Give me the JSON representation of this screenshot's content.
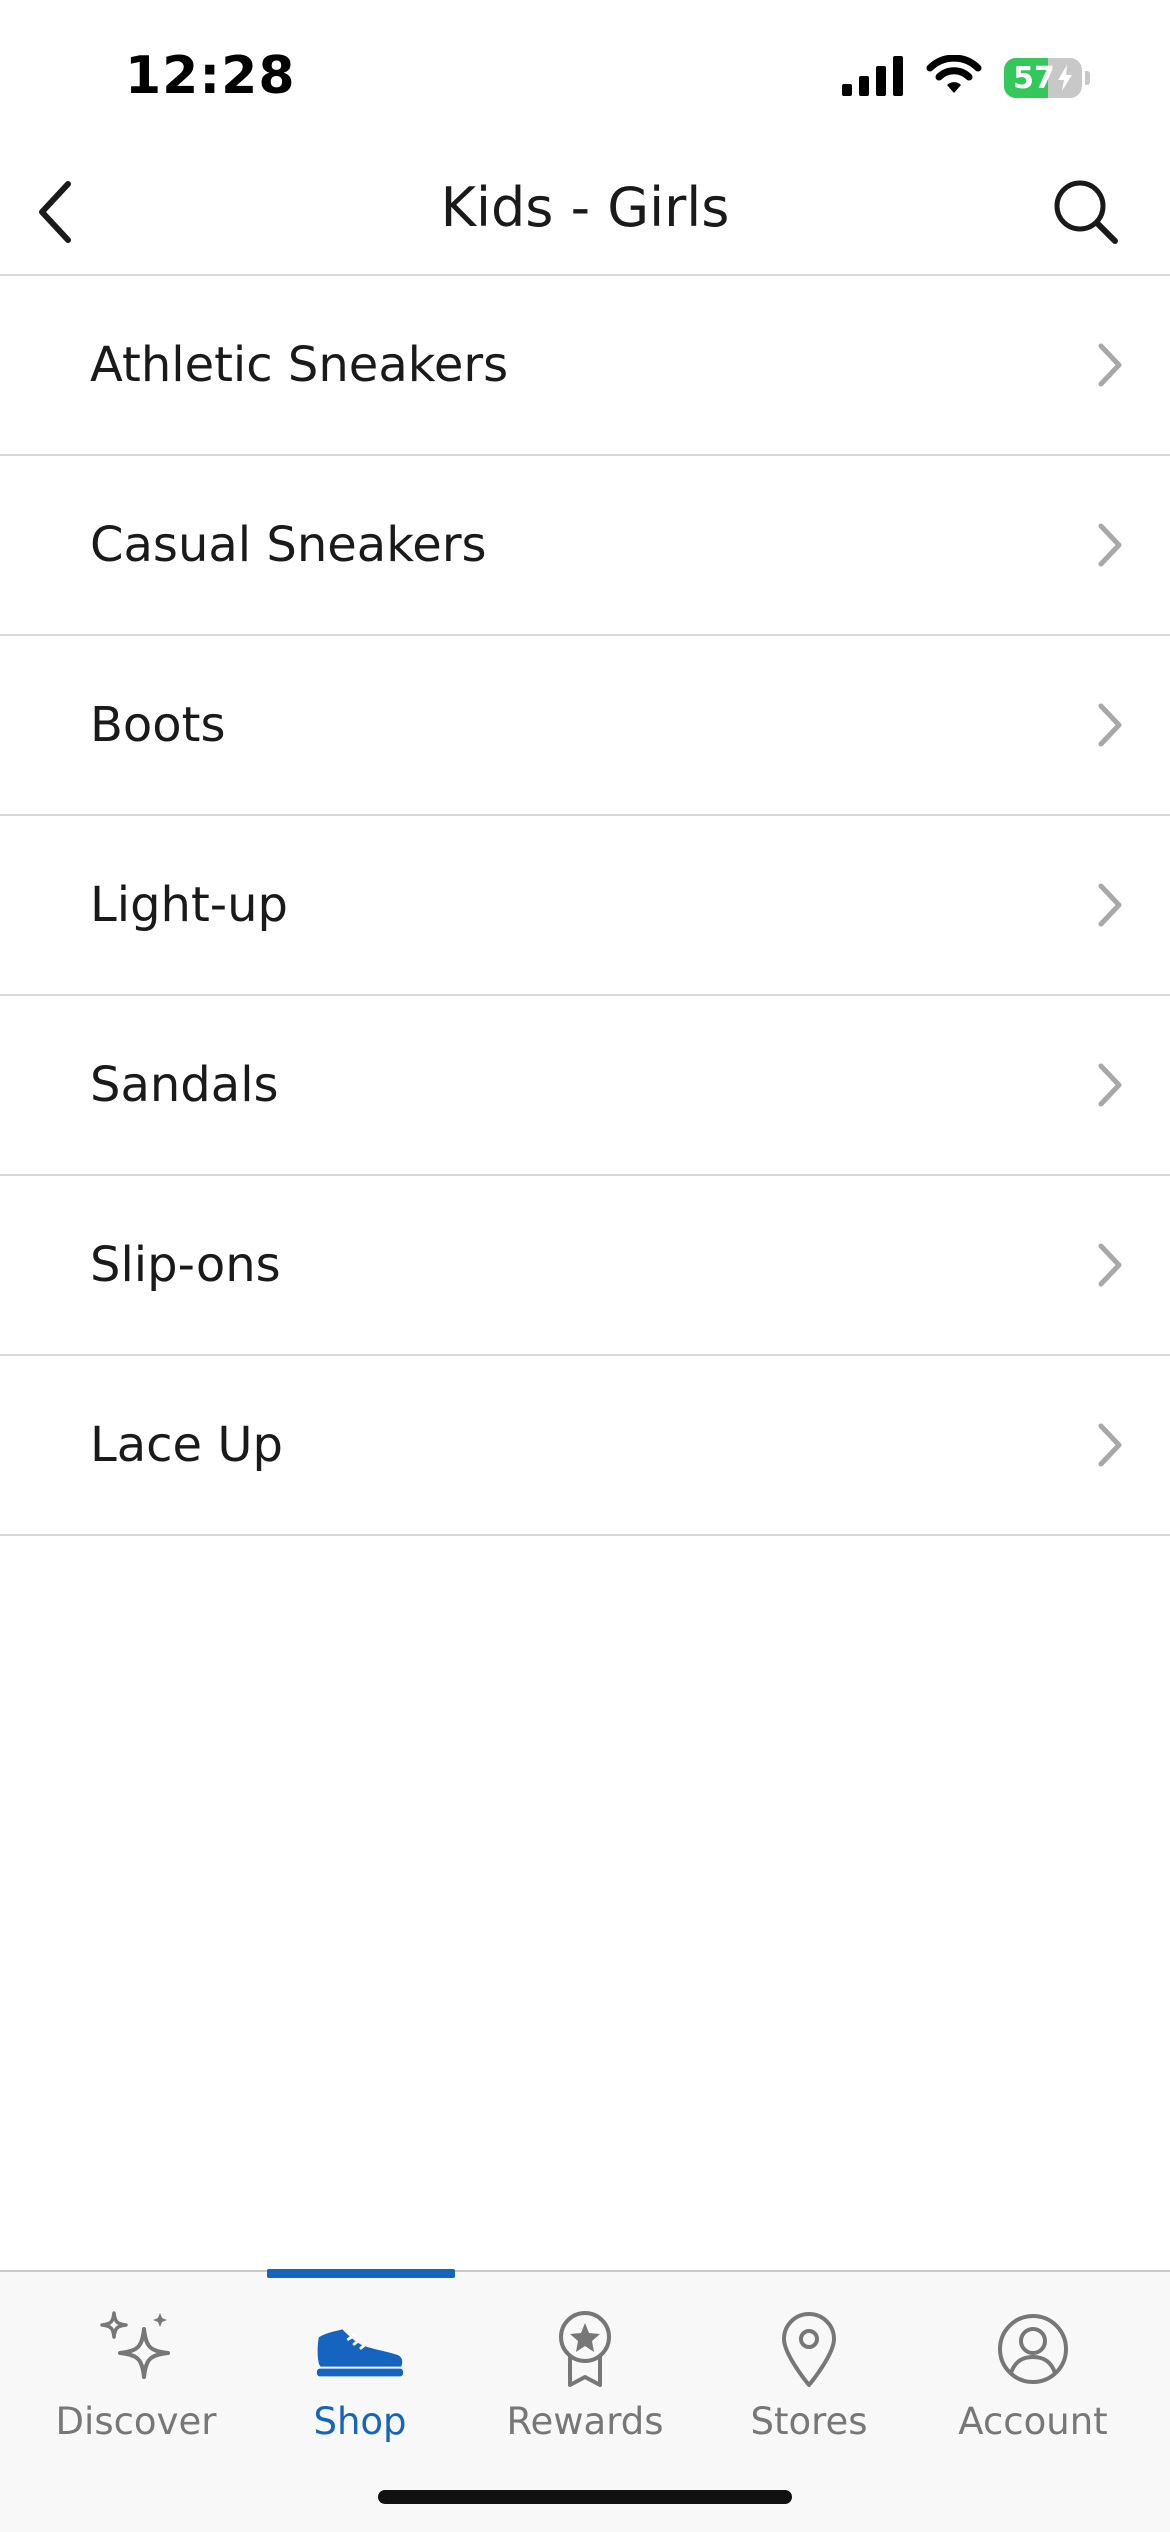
{
  "status_bar": {
    "time": "12:28",
    "battery_percent": "57",
    "battery_level": 0.57,
    "battery_color": "#34c759",
    "icons": [
      "signal-icon",
      "wifi-icon",
      "battery-icon",
      "charging-icon"
    ]
  },
  "header": {
    "title": "Kids - Girls",
    "back_icon": "back-chevron-icon",
    "search_icon": "search-icon"
  },
  "categories": [
    {
      "label": "Athletic Sneakers"
    },
    {
      "label": "Casual Sneakers"
    },
    {
      "label": "Boots"
    },
    {
      "label": "Light-up"
    },
    {
      "label": "Sandals"
    },
    {
      "label": "Slip-ons"
    },
    {
      "label": "Lace Up"
    }
  ],
  "tab_bar": {
    "accent_color": "#1565c0",
    "active_tab": "Shop",
    "tabs": [
      {
        "label": "Discover",
        "icon": "sparkles-icon"
      },
      {
        "label": "Shop",
        "icon": "sneaker-icon"
      },
      {
        "label": "Rewards",
        "icon": "rewards-badge-icon"
      },
      {
        "label": "Stores",
        "icon": "location-pin-icon"
      },
      {
        "label": "Account",
        "icon": "account-icon"
      }
    ]
  }
}
